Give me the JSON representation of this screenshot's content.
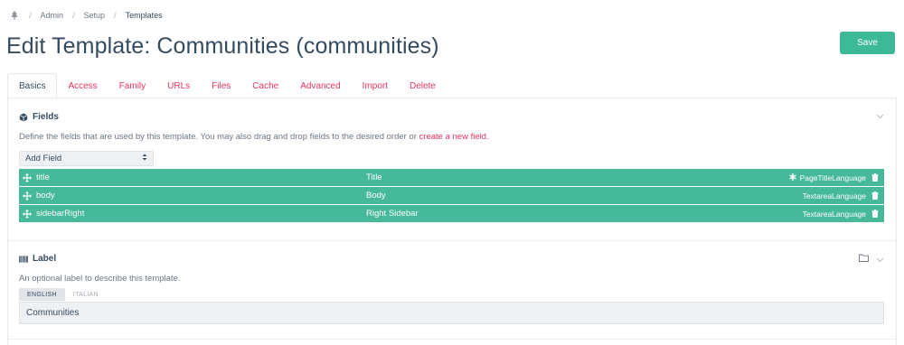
{
  "breadcrumbs": {
    "home_icon": "tree-icon",
    "items": [
      "Admin",
      "Setup",
      "Templates"
    ],
    "separator": "/"
  },
  "page": {
    "title": "Edit Template: Communities (communities)",
    "save_label": "Save"
  },
  "tabs": [
    "Basics",
    "Access",
    "Family",
    "URLs",
    "Files",
    "Cache",
    "Advanced",
    "Import",
    "Delete"
  ],
  "fields_section": {
    "heading": "Fields",
    "icon": "cube-icon",
    "description": "Define the fields that are used by this template. You may also drag and drop fields to the desired order or",
    "link_text": "create a new field.",
    "add_field_label": "Add Field",
    "rows": [
      {
        "name": "title",
        "label": "Title",
        "type": "PageTitleLanguage",
        "required": true
      },
      {
        "name": "body",
        "label": "Body",
        "type": "TextareaLanguage",
        "required": false
      },
      {
        "name": "sidebarRight",
        "label": "Right Sidebar",
        "type": "TextareaLanguage",
        "required": false
      }
    ]
  },
  "label_section": {
    "heading": "Label",
    "icon": "barcode-icon",
    "description": "An optional label to describe this template.",
    "languages": [
      "ENGLISH",
      "ITALIAN"
    ],
    "value": "Communities"
  },
  "colors": {
    "accent": "#3eb998",
    "link": "#e83561",
    "text": "#354b60"
  }
}
